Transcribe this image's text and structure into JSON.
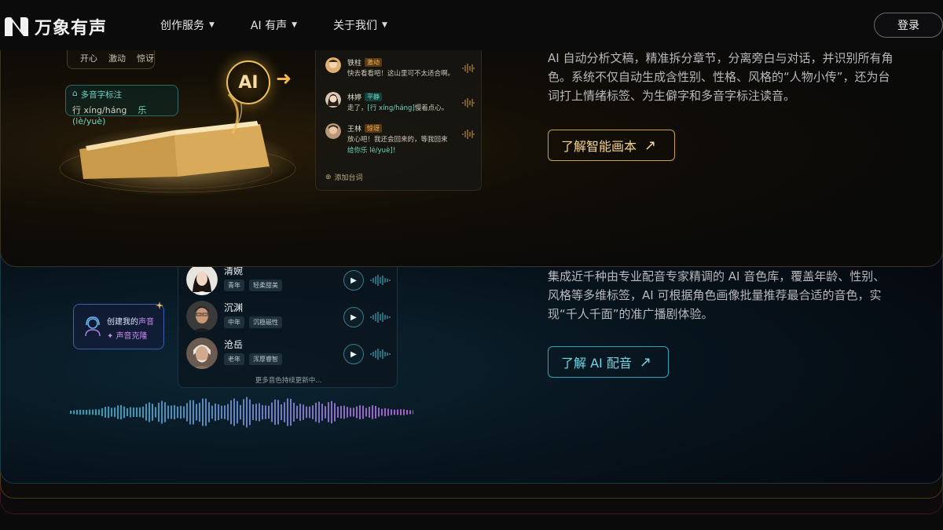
{
  "brand": {
    "name": "万象有声"
  },
  "nav": {
    "items": [
      {
        "label": "创作服务"
      },
      {
        "label": "AI 有声"
      },
      {
        "label": "关于我们"
      }
    ],
    "login_label": "登录"
  },
  "script_card": {
    "emotion_tags": [
      "开心",
      "激动",
      "惊讶"
    ],
    "pinyin_title": "多音字标注",
    "pinyin_char_a": "行",
    "pinyin_a": "xíng/háng",
    "pinyin_char_b": "乐",
    "pinyin_b": "lè/yuè)",
    "ai_label": "AI",
    "lines": [
      {
        "name": "铁柱",
        "emotion": "激动",
        "text": "快去看看吧！这山里可不太适合啊。"
      },
      {
        "name": "林婷",
        "emotion": "平静",
        "text_pre": "走了，",
        "text_py": "[行 xíng/háng]",
        "text_post": "慢着点心。"
      },
      {
        "name": "王林",
        "emotion": "惊讶",
        "text_pre": "放心吧！我还会回来的，等我回来",
        "text_py": "给你乐 lè/yuè]",
        "text_post": "！"
      }
    ],
    "add_line_label": "添加台词",
    "description": "AI 自动分析文稿，精准拆分章节，分离旁白与对话，并识别所有角色。系统不仅自动生成含性别、性格、风格的“人物小传”，还为台词打上情绪标签、为生僻字和多音字标注读音。",
    "cta_label": "了解智能画本",
    "accent": "#c9a24a"
  },
  "voice_card": {
    "create_line1_pre": "创建我的",
    "create_line1_hl": "声音",
    "create_line2": "声音克隆",
    "voices": [
      {
        "name": "清婉",
        "tags": [
          "青年",
          "轻柔甜美"
        ]
      },
      {
        "name": "沉渊",
        "tags": [
          "中年",
          "沉稳磁性"
        ]
      },
      {
        "name": "沧岳",
        "tags": [
          "老年",
          "浑厚睿智"
        ]
      }
    ],
    "more_label": "更多音色持续更新中...",
    "description": "集成近千种由专业配音专家精调的 AI 音色库，覆盖年龄、性别、风格等多维标签，AI 可根据角色画像批量推荐最合适的音色，实现“千人千面”的准广播剧体验。",
    "cta_label": "了解 AI 配音",
    "accent": "#2aa6b8"
  }
}
